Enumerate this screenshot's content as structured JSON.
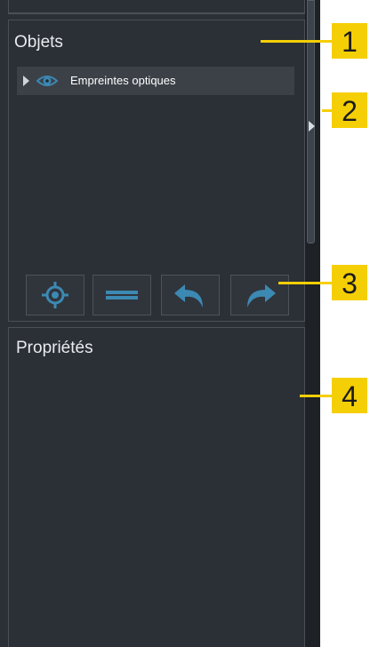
{
  "panels": {
    "objects": {
      "title": "Objets",
      "items": [
        {
          "label": "Empreintes optiques"
        }
      ]
    },
    "properties": {
      "title": "Propriétés"
    }
  },
  "toolbar": {
    "buttons": [
      {
        "icon": "crosshair-icon"
      },
      {
        "icon": "minus-icon"
      },
      {
        "icon": "undo-arrow-icon"
      },
      {
        "icon": "redo-arrow-icon"
      }
    ]
  },
  "callouts": [
    "1",
    "2",
    "3",
    "4"
  ],
  "colors": {
    "panel_bg": "#2b2f36",
    "callout": "#f5cf06",
    "icon_blue": "#3c89b3"
  }
}
